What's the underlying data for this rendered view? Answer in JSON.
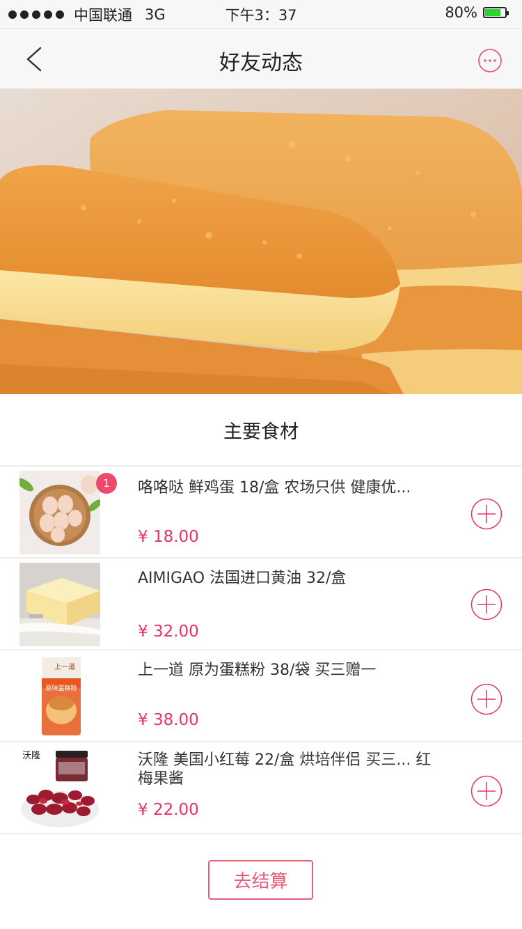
{
  "status_bar": {
    "carrier": "中国联通",
    "network": "3G",
    "time": "下午3：37",
    "battery": "80%",
    "battery_level": 0.8
  },
  "nav": {
    "title": "好友动态",
    "back_icon": "chevron-left-icon",
    "more_icon": "more-circle-icon"
  },
  "section": {
    "title": "主要食材"
  },
  "items": [
    {
      "name": "咯咯哒 鲜鸡蛋 18/盒 农场只供 健康优...",
      "price": "¥ 18.00",
      "badge": "1",
      "thumb": "eggs-image"
    },
    {
      "name": "AIMIGAO 法国进口黄油 32/盒",
      "price": "¥ 32.00",
      "badge": "",
      "thumb": "butter-image"
    },
    {
      "name": "上一道 原为蛋糕粉 38/袋  买三赠一",
      "price": "¥ 38.00",
      "badge": "",
      "thumb": "cake-flour-image"
    },
    {
      "name": "沃隆 美国小红莓 22/盒  烘培伴侣 买三... 红梅果酱",
      "price": "¥ 22.00",
      "badge": "",
      "thumb": "cranberry-image"
    }
  ],
  "thumb_text": {
    "flour_brand": "上一道",
    "flour_label": "原味蛋糕粉",
    "cranberry_brand": "沃隆"
  },
  "checkout": {
    "label": "去结算"
  },
  "colors": {
    "accent": "#e85d7a",
    "price": "#e6336a",
    "badge": "#ec4a6c",
    "battery": "#2bd62b"
  }
}
